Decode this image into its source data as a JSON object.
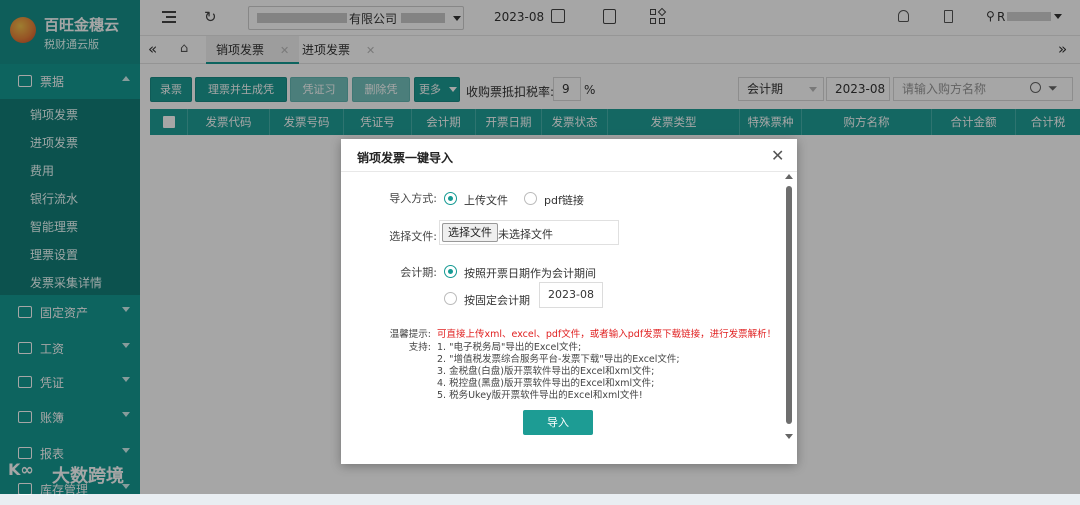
{
  "app": {
    "name": "百旺金穗云",
    "edition": "税财通云版"
  },
  "sidebar": {
    "groups": [
      {
        "label": "票据",
        "icon": "receipt-icon",
        "expanded": true
      },
      {
        "label": "固定资产",
        "icon": "building-icon"
      },
      {
        "label": "工资",
        "icon": "monitor-icon"
      },
      {
        "label": "凭证",
        "icon": "yen-icon"
      },
      {
        "label": "账簿",
        "icon": "book-icon"
      },
      {
        "label": "报表",
        "icon": "chart-icon"
      },
      {
        "label": "库存管理",
        "icon": "box-icon"
      }
    ],
    "sub_items": [
      "销项发票",
      "进项发票",
      "费用",
      "银行流水",
      "智能理票",
      "理票设置",
      "发票采集详情"
    ]
  },
  "topbar": {
    "company": "有限公司",
    "period": "2023-08",
    "user": "R"
  },
  "tabs": [
    {
      "label": "销项发票",
      "active": true
    },
    {
      "label": "进项发票"
    }
  ],
  "toolbar": {
    "buttons": [
      "录票",
      "理票并生成凭证",
      "凭证习惯",
      "删除凭证",
      "更多"
    ],
    "tax_label": "收购票抵扣税率:",
    "tax_value": "9",
    "tax_unit": "%",
    "period_select": "会计期",
    "period_value": "2023-08",
    "buyer_placeholder": "请输入购方名称"
  },
  "table": {
    "columns": [
      "发票代码",
      "发票号码",
      "凭证号",
      "会计期",
      "开票日期",
      "发票状态",
      "发票类型",
      "特殊票种",
      "购方名称",
      "合计金额",
      "合计税"
    ]
  },
  "modal": {
    "title": "销项发票一键导入",
    "import_mode_label": "导入方式:",
    "mode_options": [
      "上传文件",
      "pdf链接"
    ],
    "file_label": "选择文件:",
    "file_button": "选择文件",
    "file_status": "未选择文件",
    "period_label": "会计期:",
    "period_options": [
      "按照开票日期作为会计期间",
      "按固定会计期"
    ],
    "fixed_period": "2023-08",
    "tip_label": "温馨提示:",
    "tip_text": "可直接上传xml、excel、pdf文件，或者输入pdf发票下载链接，进行发票解析！",
    "support_label": "支持:",
    "support_items": [
      "1. \"电子税务局\"导出的Excel文件;",
      "2. \"增值税发票综合服务平台-发票下载\"导出的Excel文件;",
      "3. 金税盘(白盘)版开票软件导出的Excel和xml文件;",
      "4. 税控盘(黑盘)版开票软件导出的Excel和xml文件;",
      "5. 税务Ukey版开票软件导出的Excel和xml文件!"
    ],
    "import_button": "导入"
  },
  "watermark": {
    "text": "大数跨境"
  },
  "colors": {
    "brand": "#159a93",
    "warning": "#e02020"
  }
}
